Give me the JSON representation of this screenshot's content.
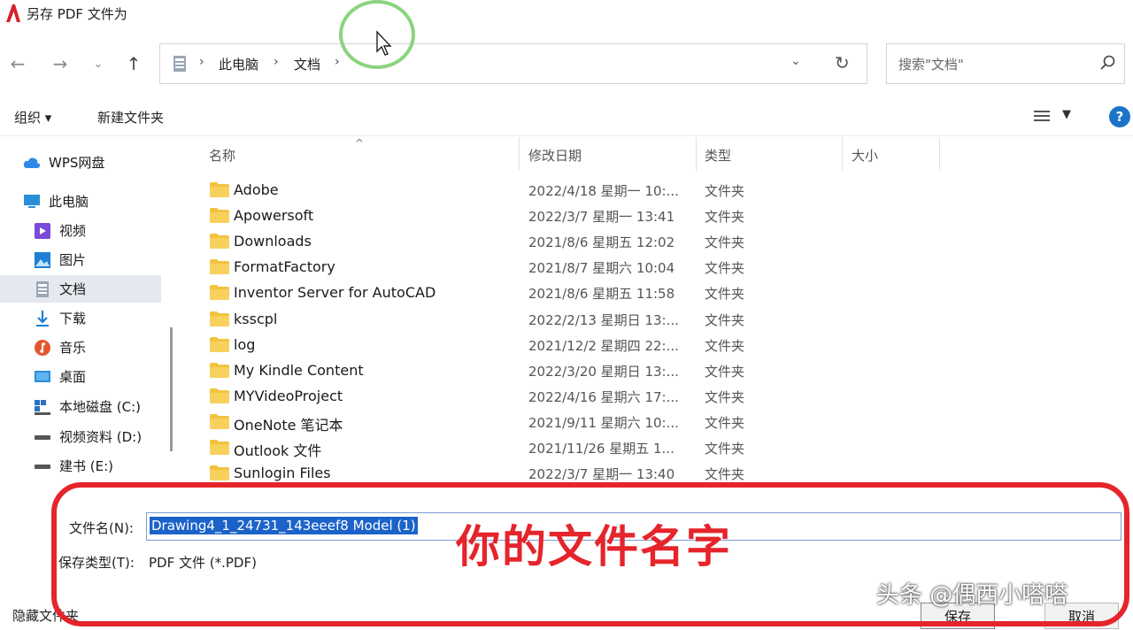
{
  "window": {
    "title": "另存 PDF 文件为"
  },
  "nav": {
    "breadcrumbs": [
      "此电脑",
      "文档"
    ],
    "search_placeholder": "搜索\"文档\""
  },
  "toolbar": {
    "organize_label": "组织 ▾",
    "new_folder_label": "新建文件夹"
  },
  "sidebar": {
    "items": [
      {
        "label": "WPS网盘",
        "icon": "cloud-icon"
      },
      {
        "label": "此电脑",
        "icon": "computer-icon"
      },
      {
        "label": "视频",
        "icon": "video-icon"
      },
      {
        "label": "图片",
        "icon": "picture-icon"
      },
      {
        "label": "文档",
        "icon": "document-icon",
        "selected": true
      },
      {
        "label": "下载",
        "icon": "download-icon"
      },
      {
        "label": "音乐",
        "icon": "music-icon"
      },
      {
        "label": "桌面",
        "icon": "desktop-icon"
      },
      {
        "label": "本地磁盘 (C:)",
        "icon": "drive-icon"
      },
      {
        "label": "视频资料 (D:)",
        "icon": "drive-icon"
      },
      {
        "label": "建书 (E:)",
        "icon": "drive-icon"
      }
    ]
  },
  "columns": {
    "name": "名称",
    "date": "修改日期",
    "type": "类型",
    "size": "大小"
  },
  "files": [
    {
      "name": "Adobe",
      "date": "2022/4/18 星期一 10:...",
      "type": "文件夹"
    },
    {
      "name": "Apowersoft",
      "date": "2022/3/7 星期一 13:41",
      "type": "文件夹"
    },
    {
      "name": "Downloads",
      "date": "2021/8/6 星期五 12:02",
      "type": "文件夹"
    },
    {
      "name": "FormatFactory",
      "date": "2021/8/7 星期六 10:04",
      "type": "文件夹"
    },
    {
      "name": "Inventor Server for AutoCAD",
      "date": "2021/8/6 星期五 11:58",
      "type": "文件夹"
    },
    {
      "name": "ksscpl",
      "date": "2022/2/13 星期日 13:...",
      "type": "文件夹"
    },
    {
      "name": "log",
      "date": "2021/12/2 星期四 22:...",
      "type": "文件夹"
    },
    {
      "name": "My Kindle Content",
      "date": "2022/3/20 星期日 13:...",
      "type": "文件夹"
    },
    {
      "name": "MYVideoProject",
      "date": "2022/4/16 星期六 17:...",
      "type": "文件夹"
    },
    {
      "name": "OneNote 笔记本",
      "date": "2021/9/11 星期六 10:...",
      "type": "文件夹"
    },
    {
      "name": "Outlook 文件",
      "date": "2021/11/26 星期五 1...",
      "type": "文件夹"
    },
    {
      "name": "Sunlogin Files",
      "date": "2022/3/7 星期一 13:40",
      "type": "文件夹"
    }
  ],
  "form": {
    "filename_label": "文件名(N):",
    "filename_value": "Drawing4_1_24731_143eeef8 Model (1)",
    "savetype_label": "保存类型(T):",
    "savetype_value": "PDF 文件 (*.PDF)",
    "hide_folders_label": "隐藏文件夹",
    "save_label": "保存",
    "cancel_label": "取消"
  },
  "annotation": {
    "text": "你的文件名字"
  },
  "watermark": {
    "text": "头条 @偶西小嗒嗒"
  },
  "colors": {
    "annotation_red": "#e5242b",
    "folder_yellow": "#f3c33f",
    "selection_blue": "#1c63c9",
    "highlight_green": "#8ad47e"
  }
}
